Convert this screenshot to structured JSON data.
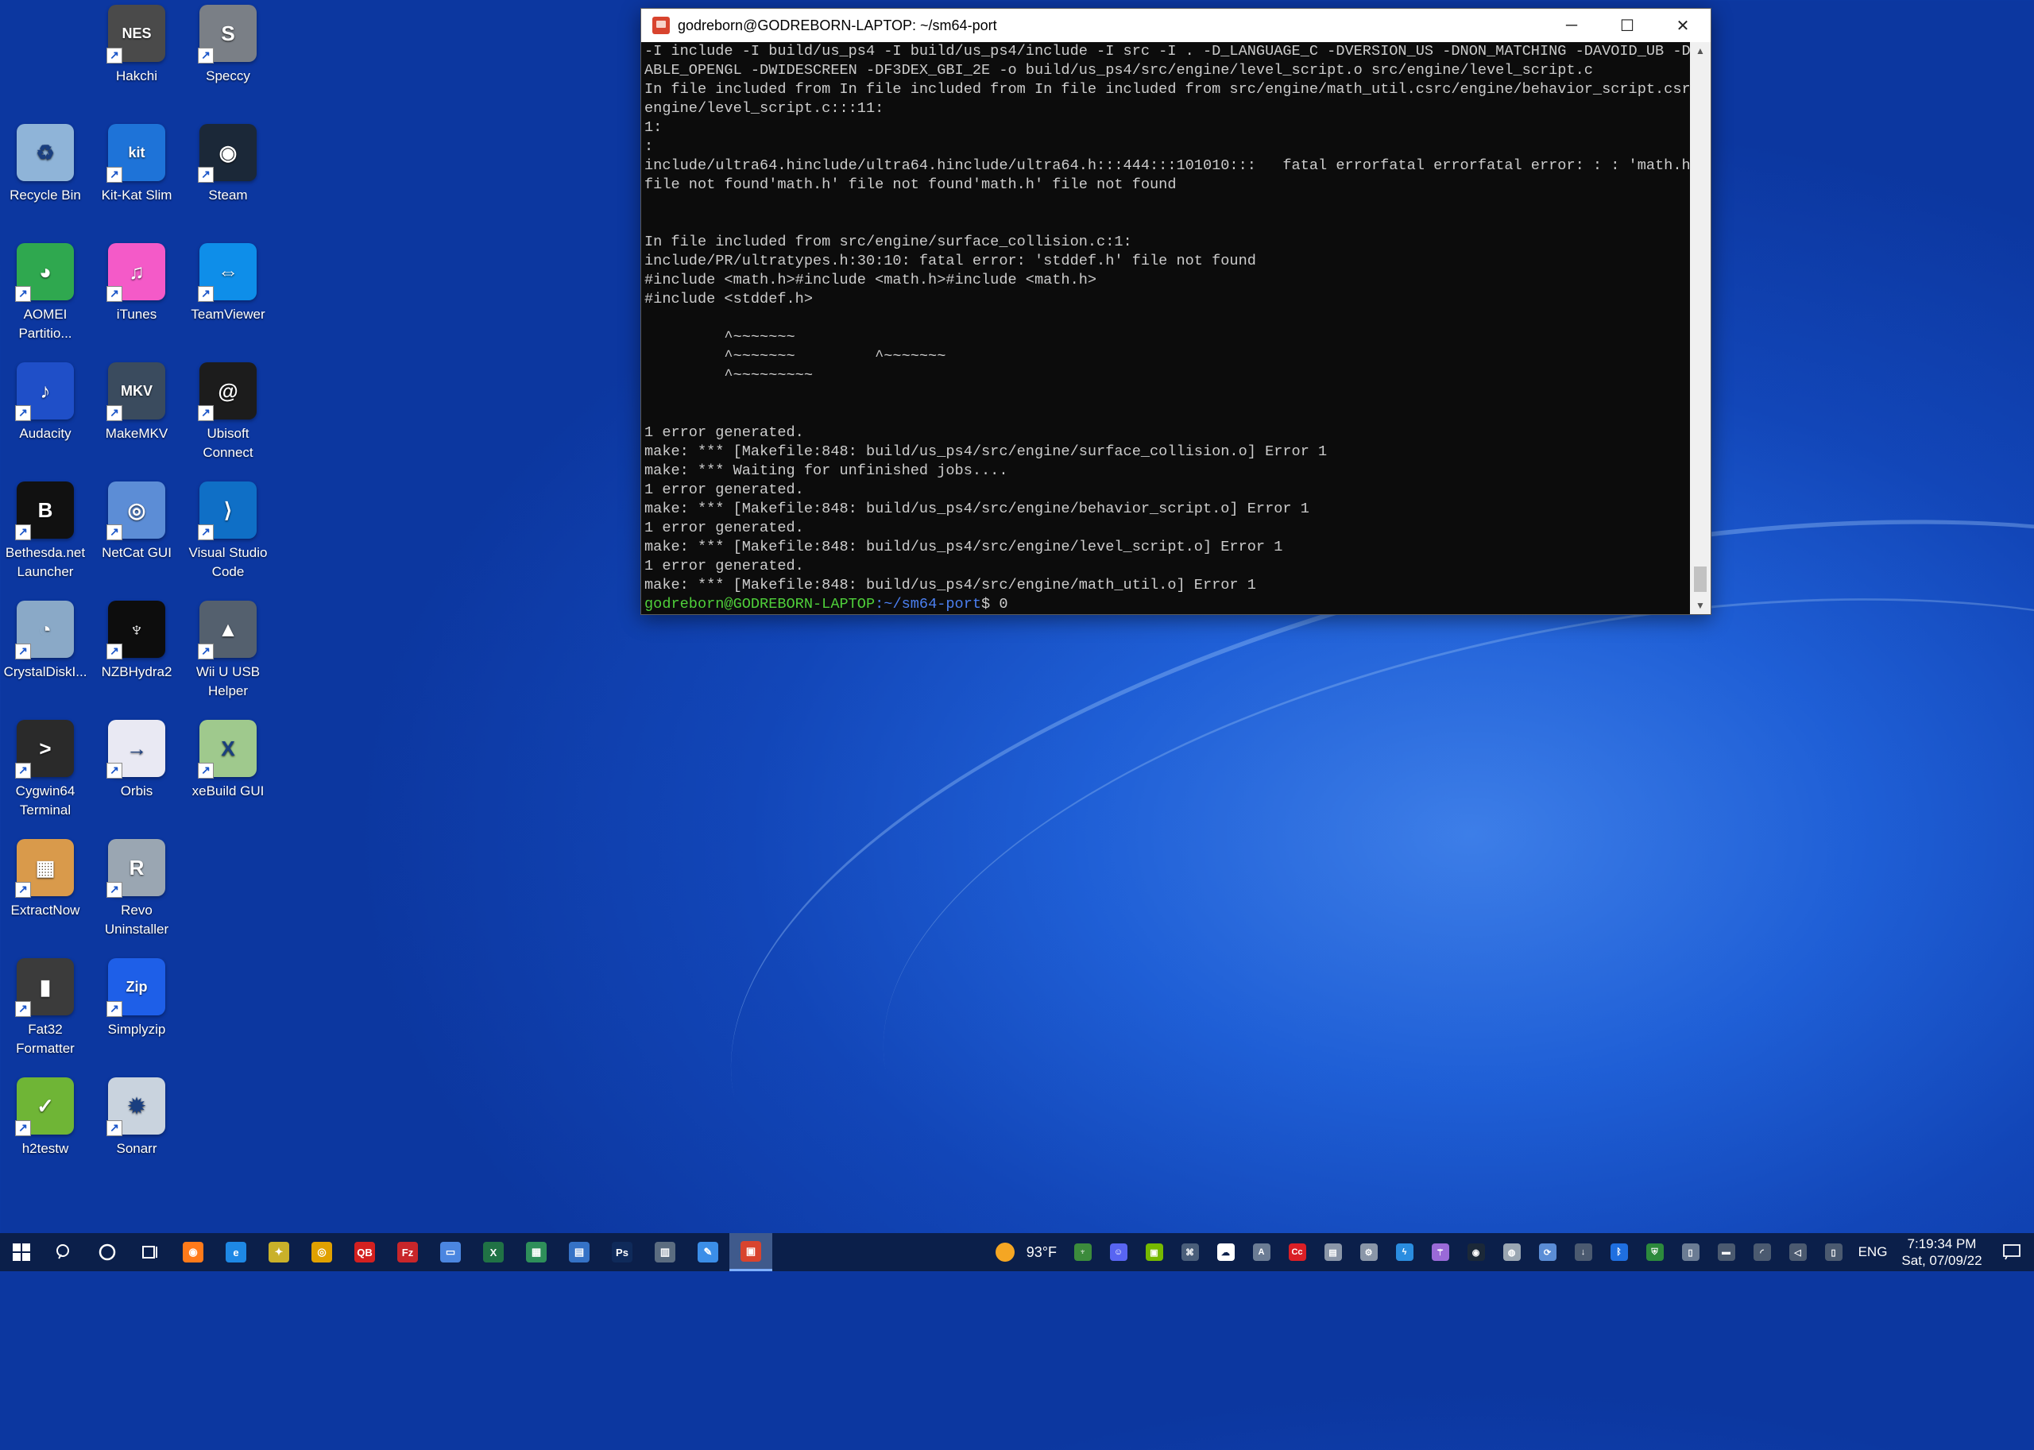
{
  "desktop": {
    "icons": [
      {
        "label": "Hakchi",
        "color": "#4a4a4a",
        "glyph": "NES"
      },
      {
        "label": "Speccy",
        "color": "#7a7f86",
        "glyph": "S"
      },
      {
        "label": "Recycle Bin",
        "color": "#8fb4d8",
        "glyph": "♻"
      },
      {
        "label": "Kit-Kat Slim",
        "color": "#1e73d8",
        "glyph": "kit"
      },
      {
        "label": "Steam",
        "color": "#1b2838",
        "glyph": "◉"
      },
      {
        "label": "AOMEI Partitio...",
        "color": "#2fa84f",
        "glyph": "◕"
      },
      {
        "label": "iTunes",
        "color": "#f45ac8",
        "glyph": "♫"
      },
      {
        "label": "TeamViewer",
        "color": "#0e8ee9",
        "glyph": "⇔"
      },
      {
        "label": "Audacity",
        "color": "#1f4fc8",
        "glyph": "♪"
      },
      {
        "label": "MakeMKV",
        "color": "#3a4b5e",
        "glyph": "MKV"
      },
      {
        "label": "Ubisoft Connect",
        "color": "#1c1c1c",
        "glyph": "@"
      },
      {
        "label": "Bethesda.net Launcher",
        "color": "#111111",
        "glyph": "B"
      },
      {
        "label": "NetCat GUI",
        "color": "#5c8dd6",
        "glyph": "◎"
      },
      {
        "label": "Visual Studio Code",
        "color": "#0f6fc6",
        "glyph": "⟩"
      },
      {
        "label": "CrystalDiskI...",
        "color": "#8aa9c7",
        "glyph": "◔"
      },
      {
        "label": "NZBHydra2",
        "color": "#0d0d0d",
        "glyph": "♆"
      },
      {
        "label": "Wii U USB Helper",
        "color": "#54606e",
        "glyph": "▲"
      },
      {
        "label": "Cygwin64 Terminal",
        "color": "#2a2a2a",
        "glyph": ">"
      },
      {
        "label": "Orbis",
        "color": "#e9e9f3",
        "glyph": "→"
      },
      {
        "label": "xeBuild GUI",
        "color": "#9fc98d",
        "glyph": "X"
      },
      {
        "label": "ExtractNow",
        "color": "#d99a4b",
        "glyph": "▦"
      },
      {
        "label": "Revo Uninstaller",
        "color": "#9aa6b2",
        "glyph": "R"
      },
      {
        "label": "Fat32 Formatter",
        "color": "#3b3b3b",
        "glyph": "▮"
      },
      {
        "label": "Simplyzip",
        "color": "#1e5fe8",
        "glyph": "Zip"
      },
      {
        "label": "h2testw",
        "color": "#6fb536",
        "glyph": "✓"
      },
      {
        "label": "Sonarr",
        "color": "#c9d3de",
        "glyph": "✹"
      }
    ]
  },
  "terminal": {
    "title": "godreborn@GODREBORN-LAPTOP: ~/sm64-port",
    "lines": [
      "-I include -I build/us_ps4 -I build/us_ps4/include -I src -I . -D_LANGUAGE_C -DVERSION_US -DNON_MATCHING -DAVOID_UB -DEN",
      "ABLE_OPENGL -DWIDESCREEN -DF3DEX_GBI_2E -o build/us_ps4/src/engine/level_script.o src/engine/level_script.c",
      "In file included from In file included from In file included from src/engine/math_util.csrc/engine/behavior_script.csrc/",
      "engine/level_script.c:::11:",
      "1:",
      ":",
      "include/ultra64.hinclude/ultra64.hinclude/ultra64.h:::444:::101010:::   fatal errorfatal errorfatal error: : : 'math.h'",
      "file not found'math.h' file not found'math.h' file not found",
      "",
      "",
      "In file included from src/engine/surface_collision.c:1:",
      "include/PR/ultratypes.h:30:10: fatal error: 'stddef.h' file not found",
      "#include <math.h>#include <math.h>#include <math.h>",
      "#include <stddef.h>",
      "",
      "         ^~~~~~~~",
      "         ^~~~~~~~         ^~~~~~~~",
      "         ^~~~~~~~~~",
      "",
      "",
      "1 error generated.",
      "make: *** [Makefile:848: build/us_ps4/src/engine/surface_collision.o] Error 1",
      "make: *** Waiting for unfinished jobs....",
      "1 error generated.",
      "make: *** [Makefile:848: build/us_ps4/src/engine/behavior_script.o] Error 1",
      "1 error generated.",
      "make: *** [Makefile:848: build/us_ps4/src/engine/level_script.o] Error 1",
      "1 error generated.",
      "make: *** [Makefile:848: build/us_ps4/src/engine/math_util.o] Error 1"
    ],
    "prompt": {
      "user": "godreborn@GODREBORN-LAPTOP",
      "path": ":~/sm64-port",
      "rest": "$ 0"
    }
  },
  "taskbar": {
    "apps": [
      {
        "name": "firefox-icon",
        "color": "#ff7a1a",
        "glyph": "◉"
      },
      {
        "name": "edge-icon",
        "color": "#1e88e5",
        "glyph": "e"
      },
      {
        "name": "hakchi-icon",
        "color": "#c9b12a",
        "glyph": "✦"
      },
      {
        "name": "chrome-icon",
        "color": "#e0a100",
        "glyph": "◎"
      },
      {
        "name": "qbittorrent-icon",
        "color": "#d32020",
        "glyph": "QB"
      },
      {
        "name": "filezilla-icon",
        "color": "#c8262a",
        "glyph": "Fz"
      },
      {
        "name": "window-icon",
        "color": "#4b86e0",
        "glyph": "▭"
      },
      {
        "name": "excel-icon",
        "color": "#207245",
        "glyph": "X"
      },
      {
        "name": "spreadsheet-icon",
        "color": "#2e8f5a",
        "glyph": "▦"
      },
      {
        "name": "remote-desktop-icon",
        "color": "#3572c6",
        "glyph": "▤"
      },
      {
        "name": "photoshop-icon",
        "color": "#0f2a5a",
        "glyph": "Ps"
      },
      {
        "name": "calculator-icon",
        "color": "#5b6c80",
        "glyph": "▥"
      },
      {
        "name": "explorer-icon",
        "color": "#3b8ee8",
        "glyph": "✎"
      },
      {
        "name": "ubuntu-terminal-icon",
        "color": "#d8442e",
        "glyph": "▣"
      }
    ],
    "weather": {
      "temp": "93°F"
    },
    "tray": [
      {
        "name": "nzbhydra-tray-icon",
        "color": "#3c8b3c",
        "glyph": "♆"
      },
      {
        "name": "discord-tray-icon",
        "color": "#5865f2",
        "glyph": "☺"
      },
      {
        "name": "nvidia-tray-icon",
        "color": "#76b900",
        "glyph": "▣"
      },
      {
        "name": "network-drive-tray-icon",
        "color": "#4a5e7a",
        "glyph": "⌘"
      },
      {
        "name": "onedrive-tray-icon",
        "color": "#ffffff",
        "glyph": "☁"
      },
      {
        "name": "font-tray-icon",
        "color": "#6b7c94",
        "glyph": "A"
      },
      {
        "name": "creative-cloud-tray-icon",
        "color": "#da1f26",
        "glyph": "Cc"
      },
      {
        "name": "printer-tray-icon",
        "color": "#8a96a8",
        "glyph": "▤"
      },
      {
        "name": "settings-tray-icon",
        "color": "#8a96a8",
        "glyph": "⚙"
      },
      {
        "name": "thunder-tray-icon",
        "color": "#2a8de0",
        "glyph": "ϟ"
      },
      {
        "name": "usb-tray-icon",
        "color": "#9a6ad8",
        "glyph": "⚚"
      },
      {
        "name": "steam-tray-icon",
        "color": "#1b2838",
        "glyph": "◉"
      },
      {
        "name": "gamepad-tray-icon",
        "color": "#9aa6b2",
        "glyph": "◍"
      },
      {
        "name": "sync-tray-icon",
        "color": "#5b8dd6",
        "glyph": "⟳"
      },
      {
        "name": "download-tray-icon",
        "color": "#4b5a70",
        "glyph": "↓"
      },
      {
        "name": "bluetooth-tray-icon",
        "color": "#1f6fe0",
        "glyph": "ᛒ"
      },
      {
        "name": "security-tray-icon",
        "color": "#2c8a3c",
        "glyph": "⛨"
      },
      {
        "name": "phone-tray-icon",
        "color": "#6b7c94",
        "glyph": "▯"
      },
      {
        "name": "battery-tray-icon",
        "color": "#4b5a70",
        "glyph": "▬"
      },
      {
        "name": "wifi-tray-icon",
        "color": "#4b5a70",
        "glyph": "◜"
      },
      {
        "name": "volume-tray-icon",
        "color": "#4b5a70",
        "glyph": "◁"
      },
      {
        "name": "pen-tray-icon",
        "color": "#4b5a70",
        "glyph": "▯"
      }
    ],
    "language": "ENG",
    "time": "7:19:34 PM",
    "date": "Sat, 07/09/22"
  }
}
